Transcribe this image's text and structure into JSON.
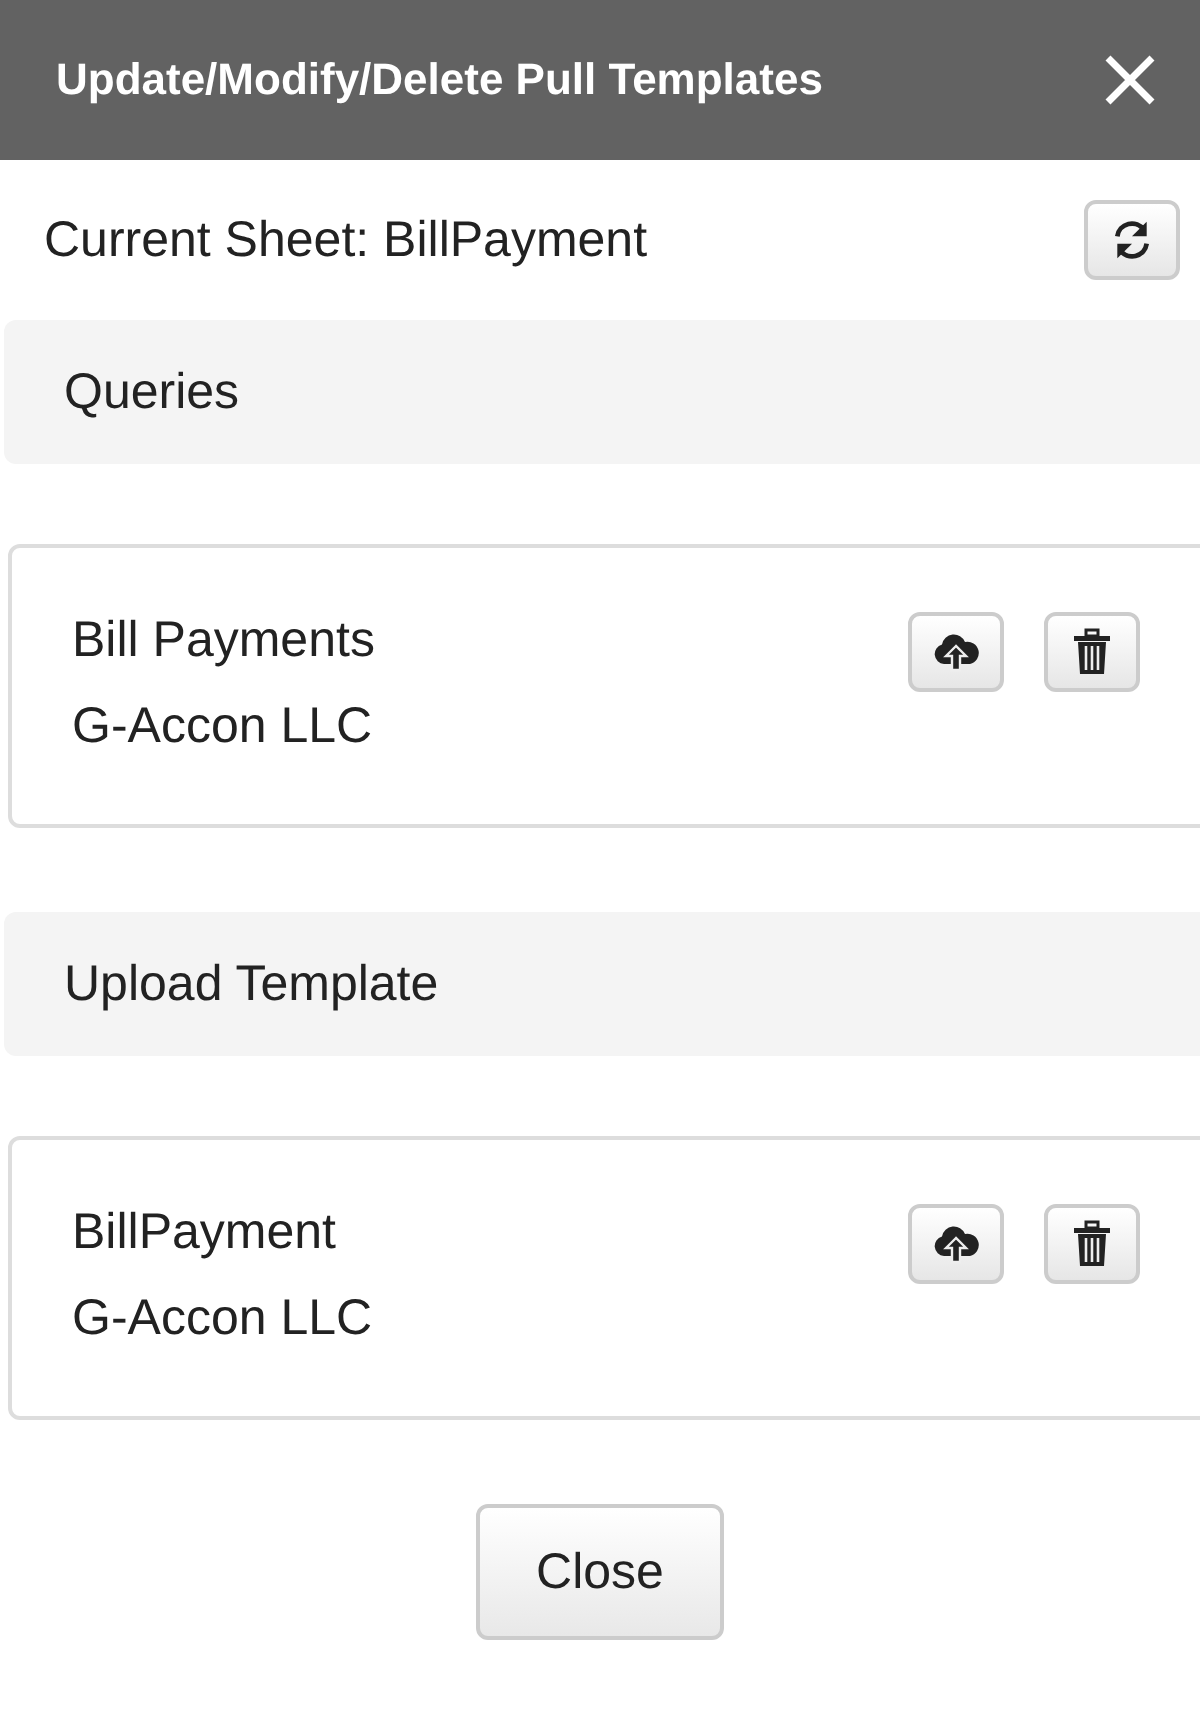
{
  "dialog": {
    "title": "Update/Modify/Delete Pull Templates"
  },
  "current_sheet": "Current Sheet: BillPayment",
  "sections": [
    {
      "title": "Queries",
      "items": [
        {
          "name": "Bill Payments",
          "company": "G-Accon LLC"
        }
      ]
    },
    {
      "title": "Upload Template",
      "items": [
        {
          "name": "BillPayment",
          "company": "G-Accon LLC"
        }
      ]
    }
  ],
  "buttons": [
    "Close"
  ]
}
